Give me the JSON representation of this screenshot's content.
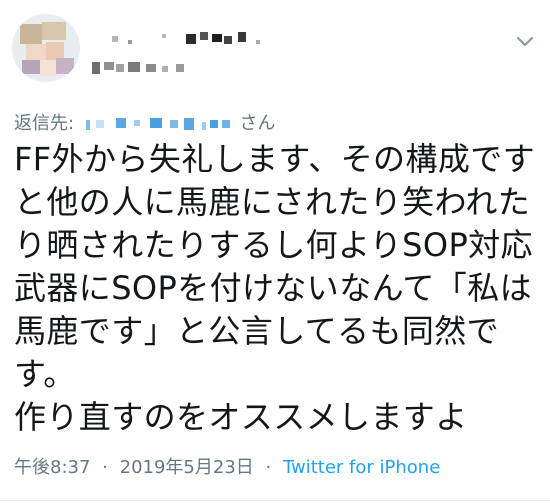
{
  "tweet": {
    "reply_to_label": "返信先:",
    "reply_to_suffix": "さん",
    "text": "FF外から失礼します、その構成です\nと他の人に馬鹿にされたり笑われた\nり晒されたりするし何よりSOP対応\n武器にSOPを付けないなんて「私は\n馬鹿です」と公言してるも同然で\nす。\n作り直すのをオススメしますよ",
    "time": "午後8:37",
    "separator": "·",
    "date": "2019年5月23日",
    "source": "Twitter for iPhone"
  },
  "icons": {
    "menu": "chevron-down-icon"
  },
  "colors": {
    "text": "#14171a",
    "secondary": "#657786",
    "link": "#1da1f2",
    "divider": "#e6ecf0"
  }
}
